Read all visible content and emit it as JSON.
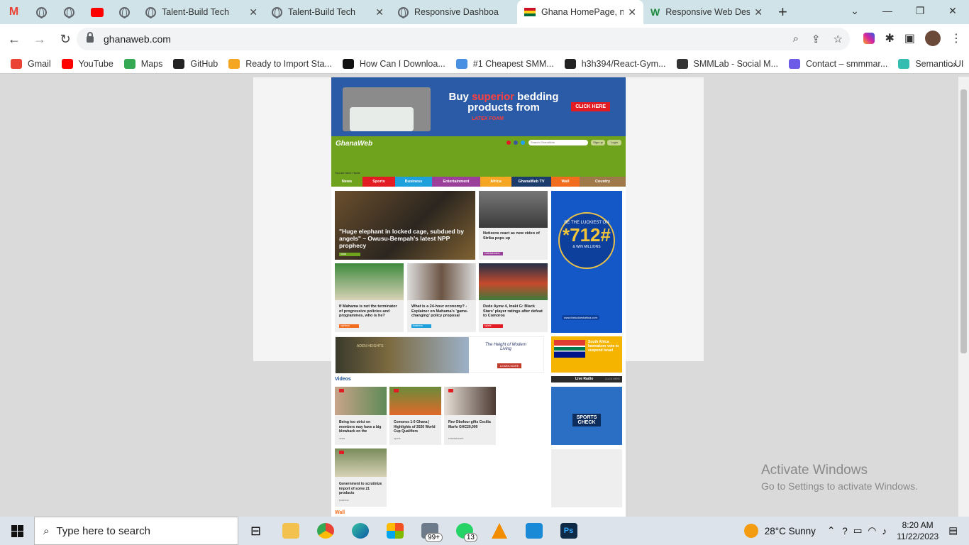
{
  "browser": {
    "tabs": [
      {
        "title": "Talent-Build Tech",
        "active": false
      },
      {
        "title": "Talent-Build Tech",
        "active": false
      },
      {
        "title": "Responsive Dashboa",
        "active": false
      },
      {
        "title": "Ghana HomePage, n",
        "active": true
      },
      {
        "title": "Responsive Web Des",
        "active": false
      }
    ],
    "url": "ghanaweb.com",
    "bookmarks": [
      {
        "label": "Gmail",
        "color": "#ea4335"
      },
      {
        "label": "YouTube",
        "color": "#ff0000"
      },
      {
        "label": "Maps",
        "color": "#34a853"
      },
      {
        "label": "GitHub",
        "color": "#222222"
      },
      {
        "label": "Ready to Import Sta...",
        "color": "#f5a623"
      },
      {
        "label": "How Can I Downloa...",
        "color": "#111111"
      },
      {
        "label": "#1 Cheapest SMM...",
        "color": "#4a90e2"
      },
      {
        "label": "h3h394/React-Gym...",
        "color": "#222222"
      },
      {
        "label": "SMMLab - Social M...",
        "color": "#333333"
      },
      {
        "label": "Contact – smmmar...",
        "color": "#6c5ce7"
      },
      {
        "label": "Semantic UI",
        "color": "#35bdb2"
      }
    ],
    "more": "»"
  },
  "site": {
    "ad_top": {
      "line1a": "Buy ",
      "highlight": "superior",
      "line1b": " bedding",
      "line2": "products from",
      "brand": "LATEX FOAM",
      "cta": "CLICK HERE"
    },
    "logo": "GhanaWeb",
    "search_placeholder": "Search GhanaWeb",
    "signup": "Sign up",
    "login": "Login",
    "crumb": "You are here: Home",
    "nav": [
      {
        "label": "News",
        "color": "#6fa21d"
      },
      {
        "label": "Sports",
        "color": "#e31b23"
      },
      {
        "label": "Business",
        "color": "#1ea0dc"
      },
      {
        "label": "Entertainment",
        "color": "#9b3f9b"
      },
      {
        "label": "Africa",
        "color": "#f5a623"
      },
      {
        "label": "GhanaWeb TV",
        "color": "#1d3c6e"
      },
      {
        "label": "Wall",
        "color": "#f26c1d"
      },
      {
        "label": "Country",
        "color": "#a0794a"
      }
    ],
    "hero": {
      "title": "\"Huge elephant in locked cage, subdued by angels\" – Owusu-Bempah's latest NPP prophecy",
      "tag": "news"
    },
    "story2": {
      "title": "Netizens react as new video of Strika pops up",
      "tag": "entertainment"
    },
    "row2": [
      {
        "title": "If Mahama is not the terminator of progressive policies and programmes, who is he?",
        "tag": "opinions",
        "tagcolor": "#f26c1d"
      },
      {
        "title": "What is a 24-hour economy? - Explainer on Mahama's 'game-changing' policy proposal",
        "tag": "business",
        "tagcolor": "#1ea0dc"
      },
      {
        "title": "Dede Ayew 4, Inaki G: Black Stars' player ratings after defeat to Comoros",
        "tag": "sports",
        "tagcolor": "#e31b23"
      }
    ],
    "side_ad": {
      "top": "BE THE LUCKIEST ON",
      "code": "*712#",
      "bottom": "& WIN MILLIONS",
      "url": "www.theluckiestafrica.com"
    },
    "mid_ad": {
      "brand": "ADEN HEIGHTS",
      "tag": "The Height of Modern Living",
      "cta": "LEARN MORE"
    },
    "sa_story": "South Africa lawmakers vote to suspend Israel",
    "videos_label": "Videos",
    "videos": [
      {
        "title": "Being too strict on members may have a big blowback on the",
        "cat": "news"
      },
      {
        "title": "Comoros 1-0 Ghana | Highlights of 2026 World Cup Qualifiers",
        "cat": "sports"
      },
      {
        "title": "Rev Obofour gifts Cecilia Marfo GHC20,000",
        "cat": "entertainment"
      },
      {
        "title": "Government to scrutinize import of some 21 products",
        "cat": "business"
      }
    ],
    "live_radio": "Live Radio",
    "click_here": "CLICK HERE",
    "sports_check": "SPORTS CHECK",
    "wall_label": "Wall"
  },
  "watermark": {
    "line1": "Activate Windows",
    "line2": "Go to Settings to activate Windows."
  },
  "taskbar": {
    "search": "Type here to search",
    "mail_badge": "99+",
    "whatsapp_badge": "13",
    "weather": "28°C  Sunny",
    "time": "8:20 AM",
    "date": "11/22/2023"
  }
}
